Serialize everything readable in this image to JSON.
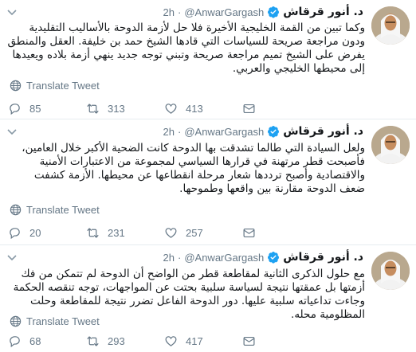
{
  "tweets": [
    {
      "name": "د. أنور قرقاش",
      "handle": "@AnwarGargash",
      "separator": "·",
      "time": "2h",
      "text": "وكما تبين من القمة الخليجية الأخيرة فلا حل لأزمة الدوحة بالأساليب التقليدية ودون مراجعة صريحة للسياسات التي قادها الشيخ حمد بن خليفة. العقل والمنطق يفرض على الشيخ تميم مراجعة صريحة وتبني توجه جديد ينهي أزمة بلاده ويعيدها إلى محيطها الخليجي والعربي.",
      "translate": "Translate Tweet",
      "replies": "85",
      "retweets": "313",
      "likes": "413"
    },
    {
      "name": "د. أنور قرقاش",
      "handle": "@AnwarGargash",
      "separator": "·",
      "time": "2h",
      "text": "ولعل السيادة التي طالما تشدقت بها الدوحة كانت الضحية الأكبر خلال العامين، فأصبحت قطر مرتهنة في قرارها السياسي لمجموعة من الاعتبارات الأمنية والاقتصادية وأصبح ترددها شعار مرحلة انقطاعها عن محيطها. الأزمة كشفت ضعف الدوحة مقارنة بين واقعها وطموحها.",
      "translate": "Translate Tweet",
      "replies": "20",
      "retweets": "231",
      "likes": "257"
    },
    {
      "name": "د. أنور قرقاش",
      "handle": "@AnwarGargash",
      "separator": "·",
      "time": "2h",
      "text": "مع حلول الذكرى الثانية لمقاطعة قطر من الواضح أن الدوحة لم تتمكن من فك أزمتها بل عمقتها نتيجة لسياسة سلبية بحتت عن المواجهات، توجه تنقصه الحكمة وجاءت تداعياته سلبية عليها. دور الدوحة الفاعل تضرر نتيجة للمقاطعة وحلت المظلومية محله.",
      "translate": "Translate Tweet",
      "replies": "68",
      "retweets": "293",
      "likes": "417"
    }
  ],
  "colors": {
    "verified": "#1da1f2",
    "muted": "#657786",
    "divider": "#e6ecf0"
  }
}
